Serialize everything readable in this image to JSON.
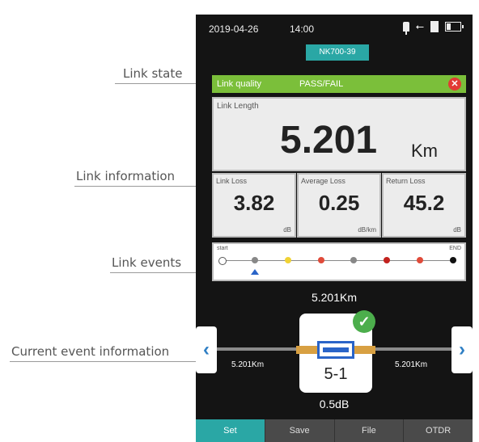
{
  "callouts": {
    "link_state": "Link state",
    "link_information": "Link information",
    "link_events": "Link events",
    "current_event_information": "Current event information"
  },
  "status_bar": {
    "date": "2019-04-26",
    "time": "14:00",
    "icons": [
      "power-plug-icon",
      "usb-icon",
      "sd-card-icon",
      "battery-icon"
    ]
  },
  "device_badge": "NK700-39",
  "link_quality": {
    "label": "Link quality",
    "result": "PASS/FAIL",
    "status_icon": "fail-x-icon",
    "bar_color": "#7bbf3a"
  },
  "link_length": {
    "label": "Link Length",
    "value": "5.201",
    "unit": "Km"
  },
  "metrics": [
    {
      "label": "Link Loss",
      "value": "3.82",
      "unit": "dB"
    },
    {
      "label": "Average Loss",
      "value": "0.25",
      "unit": "dB/km"
    },
    {
      "label": "Return Loss",
      "value": "45.2",
      "unit": "dB"
    }
  ],
  "link_events": {
    "start_label": "start",
    "end_label": "END",
    "events": [
      {
        "type": "start",
        "color": "#ffffff"
      },
      {
        "type": "event",
        "color": "#888888"
      },
      {
        "type": "event",
        "color": "#f0d234"
      },
      {
        "type": "event",
        "color": "#e04b3a"
      },
      {
        "type": "event",
        "color": "#888888"
      },
      {
        "type": "event",
        "color": "#c2221e"
      },
      {
        "type": "event",
        "color": "#e04b3a"
      },
      {
        "type": "end",
        "color": "#111111"
      }
    ],
    "selected_index": 1
  },
  "current_event": {
    "distance_top": "5.201Km",
    "distance_left": "5.201Km",
    "distance_right": "5.201Km",
    "event_id": "5-1",
    "loss": "0.5dB",
    "status_icon": "check-icon"
  },
  "tabs": [
    {
      "label": "Set",
      "active": true
    },
    {
      "label": "Save",
      "active": false
    },
    {
      "label": "File",
      "active": false
    },
    {
      "label": "OTDR",
      "active": false
    }
  ],
  "colors": {
    "accent": "#2aa7a5",
    "pass": "#4cae4c",
    "fail": "#e23b34",
    "selected": "#2a64c8"
  }
}
